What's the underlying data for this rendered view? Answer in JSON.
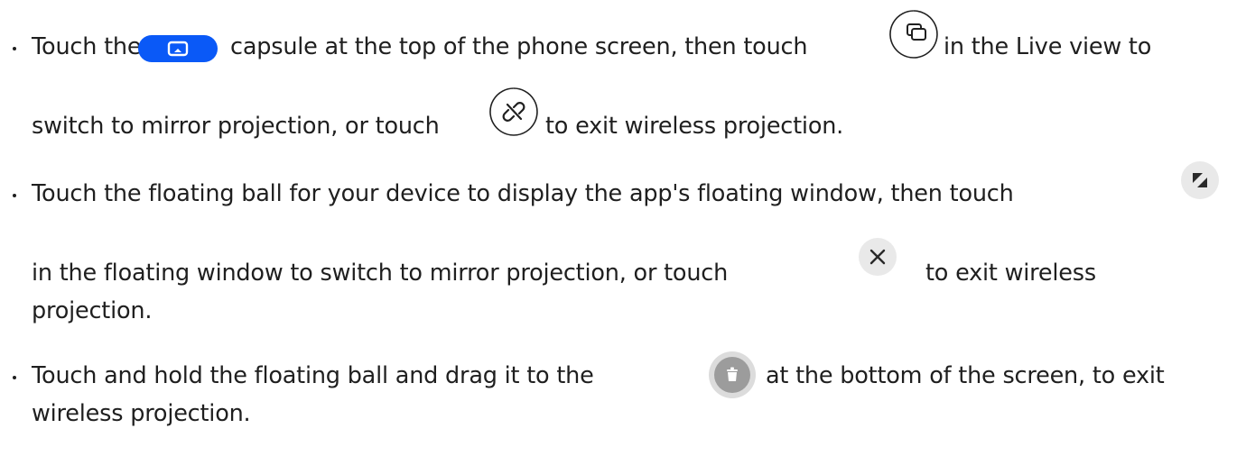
{
  "icons": {
    "capsule": "projection-capsule-icon",
    "mirror": "switch-to-mirror-icon",
    "unlink": "exit-projection-unlink-icon",
    "expand": "floating-window-expand-icon",
    "close": "close-x-icon",
    "trash": "trash-delete-icon"
  },
  "colors": {
    "text": "#1f1f1f",
    "capsule_blue": "#0a59f7",
    "icon_bg": "#e9e9e9",
    "trash_bg": "#9c9c9c",
    "trash_ring": "#dcdcdc"
  },
  "bullets": [
    {
      "lines": [
        {
          "before": "Touch the",
          "middle": "capsule at the top of the phone screen, then touch",
          "after": "in the Live view to"
        },
        {
          "before": "switch to mirror projection, or touch",
          "after": "to exit wireless projection."
        }
      ]
    },
    {
      "lines": [
        {
          "before": "Touch the floating ball for your device to display the app's floating window, then touch"
        },
        {
          "before": "in the floating window to switch to mirror projection, or touch",
          "after": "to exit wireless"
        },
        {
          "before": "projection."
        }
      ]
    },
    {
      "lines": [
        {
          "before": "Touch and hold the floating ball and drag it to the",
          "after": "at the bottom of the screen, to exit"
        },
        {
          "before": "wireless projection."
        }
      ]
    }
  ]
}
